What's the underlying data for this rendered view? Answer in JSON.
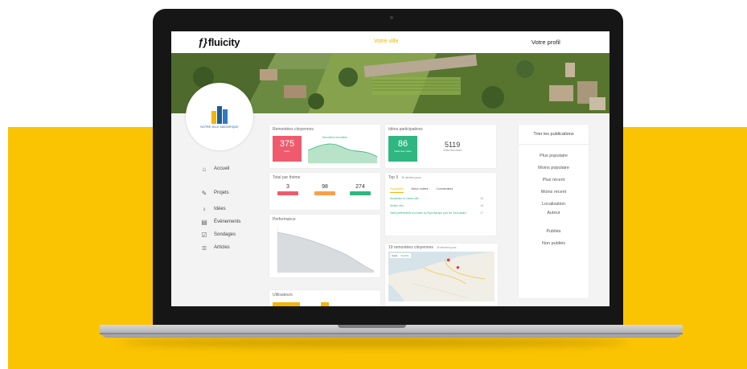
{
  "header": {
    "logo_text": "fluicity",
    "city_link": "Votre ville",
    "profile_link": "Votre profil"
  },
  "profile": {
    "city_label": "NOTRE VILLE MAGNIFIQUE"
  },
  "sidebar": {
    "items": [
      {
        "label": "Accueil",
        "icon": "home-icon"
      },
      {
        "label": "Projets",
        "icon": "tools-icon"
      },
      {
        "label": "Idées",
        "icon": "lightbulb-icon"
      },
      {
        "label": "Événements",
        "icon": "calendar-icon"
      },
      {
        "label": "Sondages",
        "icon": "poll-icon"
      },
      {
        "label": "Articles",
        "icon": "newspaper-icon"
      }
    ]
  },
  "remontees": {
    "title": "Remontées citoyennes",
    "value": "375",
    "sub": "Idées",
    "legend": "Nouvelles remontées"
  },
  "theme": {
    "title": "Total par thème",
    "items": [
      {
        "value": "3",
        "color": "#ef5b6d"
      },
      {
        "value": "98",
        "color": "#f6a04d"
      },
      {
        "value": "274",
        "color": "#2fb681"
      }
    ]
  },
  "performance": {
    "title": "Performance"
  },
  "utilisateurs": {
    "title": "Utilisateurs"
  },
  "idees": {
    "title": "Idées participatives",
    "value": "86",
    "sub": "Idées des votes",
    "value2": "5119",
    "sub2": "Votes des idées"
  },
  "top": {
    "title": "Top 5",
    "period": "30 derniers jours",
    "tabs": [
      "Populaires",
      "Mieux notées",
      "Commentées"
    ],
    "rows": [
      {
        "label": "Dynamiser le Centre-ville",
        "count": "48"
      },
      {
        "label": "Sentier vélo",
        "count": "35"
      },
      {
        "label": "Tarifs préférentiels au musée du Pays Basque pour les Toulousains",
        "count": "27"
      }
    ]
  },
  "map_card": {
    "title": "19 remontées citoyennes",
    "period": "30 derniers jours",
    "map_tabs": [
      "Carte",
      "Satellite"
    ]
  },
  "sort": {
    "title": "Trier les publications",
    "options": [
      "Plus populaire",
      "Moins populaire",
      "Plus récent",
      "Moins récent",
      "Localisation",
      "Auteur",
      "Publiés",
      "Non publiés"
    ]
  },
  "colors": {
    "brand_yellow": "#fbc403",
    "kpi_red": "#ef5b6d",
    "kpi_green": "#2fb681",
    "accent_orange": "#f6a04d"
  }
}
